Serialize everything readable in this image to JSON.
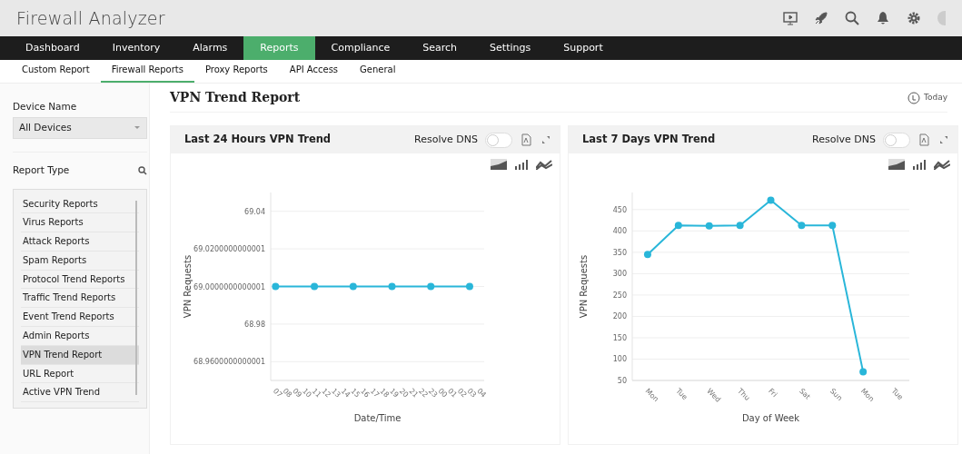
{
  "app": {
    "title": "Firewall Analyzer"
  },
  "main_nav": [
    {
      "label": "Dashboard",
      "selected": false
    },
    {
      "label": "Inventory",
      "selected": false
    },
    {
      "label": "Alarms",
      "selected": false
    },
    {
      "label": "Reports",
      "selected": true
    },
    {
      "label": "Compliance",
      "selected": false
    },
    {
      "label": "Search",
      "selected": false
    },
    {
      "label": "Settings",
      "selected": false
    },
    {
      "label": "Support",
      "selected": false
    }
  ],
  "sub_nav": [
    {
      "label": "Custom Report",
      "selected": false
    },
    {
      "label": "Firewall Reports",
      "selected": true
    },
    {
      "label": "Proxy Reports",
      "selected": false
    },
    {
      "label": "API Access",
      "selected": false
    },
    {
      "label": "General",
      "selected": false
    }
  ],
  "sidebar": {
    "device_label": "Device Name",
    "device_value": "All Devices",
    "report_type_label": "Report Type",
    "items": [
      {
        "label": "Security Reports",
        "selected": false
      },
      {
        "label": "Virus Reports",
        "selected": false
      },
      {
        "label": "Attack Reports",
        "selected": false
      },
      {
        "label": "Spam Reports",
        "selected": false
      },
      {
        "label": "Protocol Trend Reports",
        "selected": false
      },
      {
        "label": "Traffic Trend Reports",
        "selected": false
      },
      {
        "label": "Event Trend Reports",
        "selected": false
      },
      {
        "label": "Admin Reports",
        "selected": false
      },
      {
        "label": "VPN Trend Report",
        "selected": true
      },
      {
        "label": "URL Report",
        "selected": false
      },
      {
        "label": "Active VPN Trend",
        "selected": false
      }
    ]
  },
  "page": {
    "title": "VPN Trend Report",
    "period": "Today"
  },
  "cards": [
    {
      "title": "Last 24 Hours VPN Trend",
      "resolve_dns_label": "Resolve DNS",
      "resolve_dns_on": false,
      "chart_data": {
        "type": "line",
        "xlabel": "Date/Time",
        "ylabel": "VPN Requests",
        "categories": [
          "07",
          "08",
          "09",
          "10",
          "11",
          "12",
          "13",
          "14",
          "15",
          "16",
          "17",
          "18",
          "19",
          "20",
          "21",
          "22",
          "23",
          "00",
          "01",
          "02",
          "03",
          "04"
        ],
        "ylim": [
          68.95,
          69.05
        ],
        "grid": true,
        "yticks": [
          {
            "value": 68.96,
            "label": "68.9600000000001"
          },
          {
            "value": 68.98,
            "label": "68.98"
          },
          {
            "value": 69.0,
            "label": "69.0000000000001"
          },
          {
            "value": 69.02,
            "label": "69.0200000000001"
          },
          {
            "value": 69.04,
            "label": "69.04"
          }
        ],
        "series": [
          {
            "color": "#29b6d9",
            "marker": "circle",
            "values": [
              69,
              null,
              null,
              null,
              69,
              null,
              null,
              null,
              69,
              null,
              null,
              null,
              69,
              null,
              null,
              null,
              69,
              null,
              null,
              null,
              69,
              null
            ]
          }
        ]
      }
    },
    {
      "title": "Last 7 Days VPN Trend",
      "resolve_dns_label": "Resolve DNS",
      "resolve_dns_on": false,
      "chart_data": {
        "type": "line",
        "xlabel": "Day of Week",
        "ylabel": "VPN Requests",
        "categories": [
          "Mon",
          "Tue",
          "Wed",
          "Thu",
          "Fri",
          "Sat",
          "Sun",
          "Mon",
          "Tue"
        ],
        "ylim": [
          50,
          490
        ],
        "grid": true,
        "yticks": [
          50,
          100,
          150,
          200,
          250,
          300,
          350,
          400,
          450
        ],
        "series": [
          {
            "color": "#29b6d9",
            "marker": "circle",
            "values": [
              345,
              413,
              412,
              413,
              472,
              413,
              413,
              70,
              null
            ]
          }
        ]
      }
    }
  ]
}
